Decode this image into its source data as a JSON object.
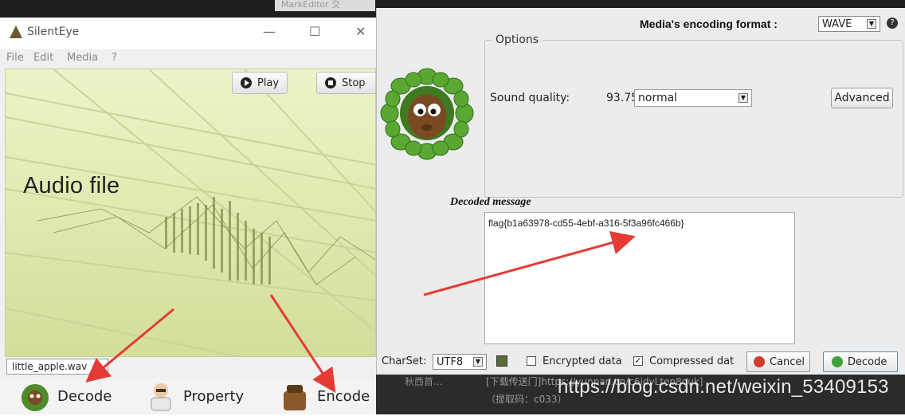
{
  "background": {
    "tab_title": "MarkEditor 交",
    "bottom_left_text": "秋西首...",
    "bottom_line1": "[下载传送门]https://yunpan.cn/c6idvLtep8quk]",
    "bottom_line2": "（提取码：c033）",
    "watermark": "https://blog.csdn.net/weixin_53409153"
  },
  "silenteye": {
    "title": "SilentEye",
    "window_controls": {
      "minimize": "—",
      "maximize": "☐",
      "close": "✕"
    },
    "menu": [
      "File",
      "Edit",
      "Media",
      "?"
    ],
    "toolbar": {
      "play_label": "Play",
      "stop_label": "Stop"
    },
    "audio_label": "Audio file",
    "file_name": "little_apple.wav",
    "actions": {
      "decode_label": "Decode",
      "property_label": "Property",
      "encode_label": "Encode"
    }
  },
  "decoder": {
    "format_label": "Media's encoding format :",
    "format_value": "WAVE",
    "help_glyph": "?",
    "options_title": "Options",
    "sound_quality_label": "Sound quality:",
    "sound_quality_value": "93.75%",
    "sound_quality_select": "normal",
    "advanced_label": "Advanced",
    "decoded_title": "Decoded message",
    "decoded_text": "flag{b1a63978-cd55-4ebf-a316-5f3a96fc466b}",
    "charset_label": "CharSet:",
    "charset_value": "UTF8",
    "encrypted_label": "Encrypted data",
    "encrypted_checked": false,
    "compressed_label": "Compressed dat",
    "compressed_checked": true,
    "cancel_label": "Cancel",
    "decode_label": "Decode"
  },
  "colors": {
    "arrow": "#e63b35",
    "audio_bg": "#e4ecb6",
    "dark_bg": "#2b2b2b"
  },
  "icons": [
    "silenteye-logo-icon",
    "play-icon",
    "stop-icon",
    "mascot-icon",
    "book-icon",
    "cancel-icon",
    "decode-check-icon"
  ]
}
